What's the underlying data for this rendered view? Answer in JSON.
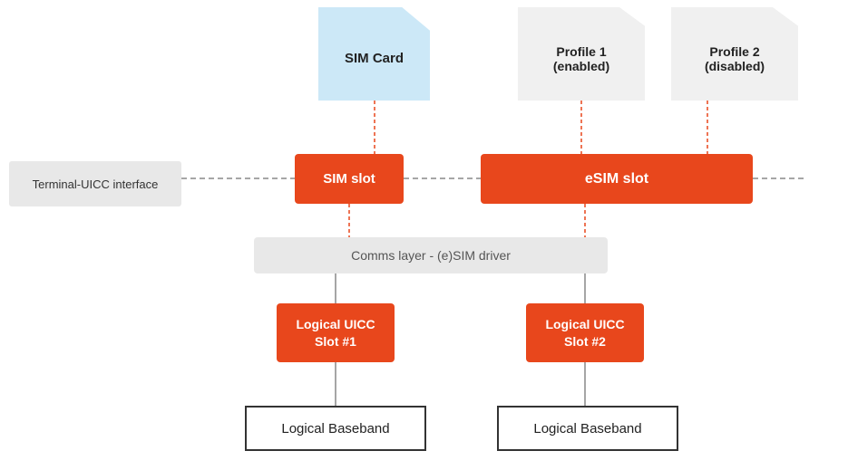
{
  "sim_card": {
    "label": "SIM\nCard"
  },
  "profile1": {
    "label": "Profile 1\n(enabled)"
  },
  "profile2": {
    "label": "Profile 2\n(disabled)"
  },
  "terminal_uicc": {
    "label": "Terminal-UICC interface"
  },
  "sim_slot": {
    "label": "SIM slot"
  },
  "esim_slot": {
    "label": "eSIM slot"
  },
  "comms_layer": {
    "label": "Comms layer - (e)SIM driver"
  },
  "logical_uicc_1": {
    "label": "Logical UICC\nSlot #1"
  },
  "logical_uicc_2": {
    "label": "Logical UICC\nSlot #2"
  },
  "logical_baseband_1": {
    "label": "Logical  Baseband"
  },
  "logical_baseband_2": {
    "label": "Logical Baseband"
  }
}
